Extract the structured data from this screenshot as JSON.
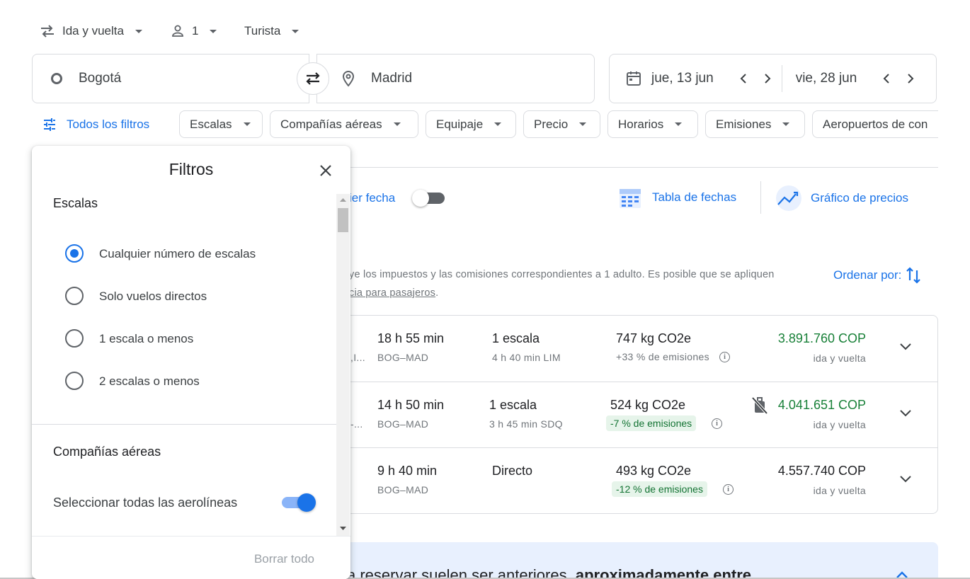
{
  "top": {
    "trip_type": "Ida y vuelta",
    "passengers": "1",
    "cabin": "Turista"
  },
  "search": {
    "origin": "Bogotá",
    "destination": "Madrid",
    "depart_date": "jue, 13 jun",
    "return_date": "vie, 28 jun"
  },
  "filters_bar": {
    "all_filters": "Todos los filtros",
    "chips": [
      "Escalas",
      "Compañías aéreas",
      "Equipaje",
      "Precio",
      "Horarios",
      "Emisiones",
      "Aeropuertos de con"
    ]
  },
  "tools": {
    "flex_date_label": "ier fecha",
    "date_table": "Tabla de fechas",
    "price_graph": "Gráfico de precios"
  },
  "info": {
    "line1": "ye los impuestos y las comisiones correspondientes a 1 adulto. Es posible que se apliquen",
    "line2_link": "cia para pasajeros",
    "line2_end": ".",
    "sort_label": "Ordenar por:"
  },
  "flights": [
    {
      "airline_frag": ",I...",
      "duration": "18 h 55 min",
      "route": "BOG–MAD",
      "stops": "1 escala",
      "stop_detail": "4 h 40 min LIM",
      "emissions": "747 kg CO2e",
      "emissions_note": "+33 % de emisiones",
      "price": "3.891.760 COP",
      "price_note": "ida y vuelta"
    },
    {
      "airline_frag": "-...",
      "duration": "14 h 50 min",
      "route": "BOG–MAD",
      "stops": "1 escala",
      "stop_detail": "3 h 45 min SDQ",
      "emissions": "524 kg CO2e",
      "emissions_note": "-7 % de emisiones",
      "price": "4.041.651 COP",
      "price_note": "ida y vuelta"
    },
    {
      "airline_frag": "",
      "duration": "9 h 40 min",
      "route": "BOG–MAD",
      "stops": "Directo",
      "stop_detail": "",
      "emissions": "493 kg CO2e",
      "emissions_note": "-12 % de emisiones",
      "price": "4.557.740 COP",
      "price_note": "ida y vuelta"
    }
  ],
  "banner": {
    "text_normal": "a reservar suelen ser anteriores, ",
    "text_bold": "aproximadamente entre"
  },
  "panel": {
    "title": "Filtros",
    "stops_section": "Escalas",
    "stop_options": [
      "Cualquier número de escalas",
      "Solo vuelos directos",
      "1 escala o menos",
      "2 escalas o menos"
    ],
    "stop_selected_index": 0,
    "airlines_section": "Compañías aéreas",
    "select_all_airlines": "Seleccionar todas las aerolíneas",
    "select_all_on": true,
    "clear_all": "Borrar todo"
  },
  "colors": {
    "accent": "#1a73e8",
    "price_green": "#188038",
    "badge_bg": "#e6f4ea"
  }
}
